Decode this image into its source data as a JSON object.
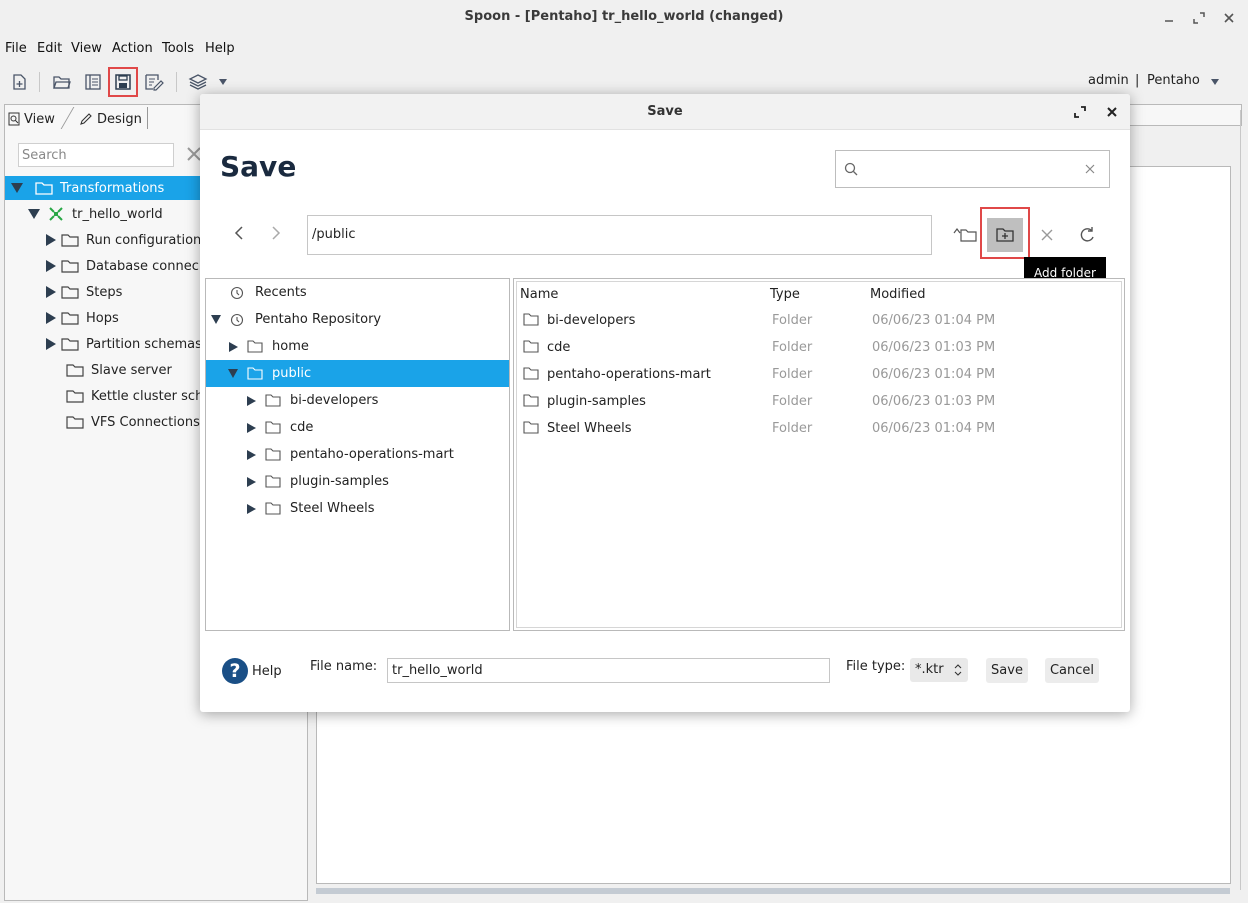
{
  "window": {
    "title": "Spoon - [Pentaho] tr_hello_world (changed)"
  },
  "menu": {
    "items": [
      "File",
      "Edit",
      "View",
      "Action",
      "Tools",
      "Help"
    ]
  },
  "toolbar": {
    "user": "admin",
    "separator": "|",
    "repository": "Pentaho",
    "highlighted_button": "save-icon"
  },
  "left_panel": {
    "tabs": [
      "View",
      "Design"
    ],
    "search_placeholder": "Search",
    "tree": {
      "root": "Transformations",
      "transformation": "tr_hello_world",
      "children": [
        "Run configuration",
        "Database connec",
        "Steps",
        "Hops",
        "Partition schemas",
        "Slave server",
        "Kettle cluster sch",
        "VFS Connections"
      ]
    }
  },
  "dialog": {
    "window_title": "Save",
    "heading": "Save",
    "search_value": "",
    "path": "/public",
    "tooltip": "Add folder",
    "tree": {
      "recents": "Recents",
      "repository": "Pentaho Repository",
      "home": "home",
      "public": "public",
      "public_children": [
        "bi-developers",
        "cde",
        "pentaho-operations-mart",
        "plugin-samples",
        "Steel Wheels"
      ]
    },
    "files": {
      "columns": [
        "Name",
        "Type",
        "Modified"
      ],
      "rows": [
        {
          "name": "bi-developers",
          "type": "Folder",
          "modified": "06/06/23 01:04 PM"
        },
        {
          "name": "cde",
          "type": "Folder",
          "modified": "06/06/23 01:03 PM"
        },
        {
          "name": "pentaho-operations-mart",
          "type": "Folder",
          "modified": "06/06/23 01:04 PM"
        },
        {
          "name": "plugin-samples",
          "type": "Folder",
          "modified": "06/06/23 01:03 PM"
        },
        {
          "name": "Steel Wheels",
          "type": "Folder",
          "modified": "06/06/23 01:04 PM"
        }
      ]
    },
    "footer": {
      "help": "Help",
      "file_name_label": "File name:",
      "file_name_value": "tr_hello_world",
      "file_type_label": "File type:",
      "file_type_value": "*.ktr",
      "save_button": "Save",
      "cancel_button": "Cancel"
    }
  },
  "colors": {
    "selection": "#1aa3e8",
    "highlight_border": "#e04848",
    "heading": "#1a2a3f"
  }
}
